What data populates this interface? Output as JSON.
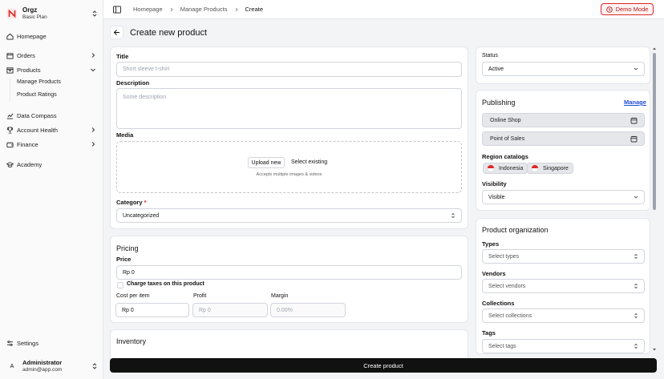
{
  "org": {
    "name": "Orgz",
    "plan": "Basic Plan"
  },
  "nav": {
    "homepage": "Homepage",
    "orders": "Orders",
    "products": "Products",
    "manage_products": "Manage Products",
    "product_ratings": "Product Ratings",
    "data_compass": "Data Compass",
    "account_health": "Account Health",
    "finance": "Finance",
    "academy": "Academy",
    "settings": "Settings"
  },
  "user": {
    "initial": "A",
    "name": "Administrator",
    "email": "admin@app.com"
  },
  "breadcrumbs": [
    "Homepage",
    "Manage Products",
    "Create"
  ],
  "demo_mode": "Demo Mode",
  "page_title": "Create new product",
  "form": {
    "title_label": "Title",
    "title_placeholder": "Short sleeve t-shirt",
    "description_label": "Description",
    "description_placeholder": "Some description",
    "media_label": "Media",
    "upload_new": "Upload new",
    "select_existing": "Select existing",
    "accepts": "Accepts multiple images & videos",
    "category_label": "Category",
    "category_required": "*",
    "category_value": "Uncategorized"
  },
  "pricing": {
    "title": "Pricing",
    "price_label": "Price",
    "price_value": "Rp 0",
    "charge_taxes": "Charge taxes on this product",
    "cost_label": "Cost per item",
    "cost_value": "Rp 0",
    "profit_label": "Profit",
    "profit_value": "Rp 0",
    "margin_label": "Margin",
    "margin_value": "0.00%"
  },
  "inventory": {
    "title": "Inventory"
  },
  "status": {
    "label": "Status",
    "value": "Active"
  },
  "publishing": {
    "title": "Publishing",
    "manage": "Manage",
    "channels": [
      "Online Shop",
      "Point of Sales"
    ],
    "region_label": "Region catalogs",
    "regions": [
      "Indonesia",
      "Singapore"
    ],
    "visibility_label": "Visibility",
    "visibility_value": "Visible"
  },
  "organization": {
    "title": "Product organization",
    "types_label": "Types",
    "types_placeholder": "Select types",
    "vendors_label": "Vendors",
    "vendors_placeholder": "Select vendors",
    "collections_label": "Collections",
    "collections_placeholder": "Select collections",
    "tags_label": "Tags",
    "tags_placeholder": "Select tags"
  },
  "submit_label": "Create product",
  "colors": {
    "accent_red": "#dc2626",
    "primary": "#111111",
    "link": "#1d4ed8"
  }
}
